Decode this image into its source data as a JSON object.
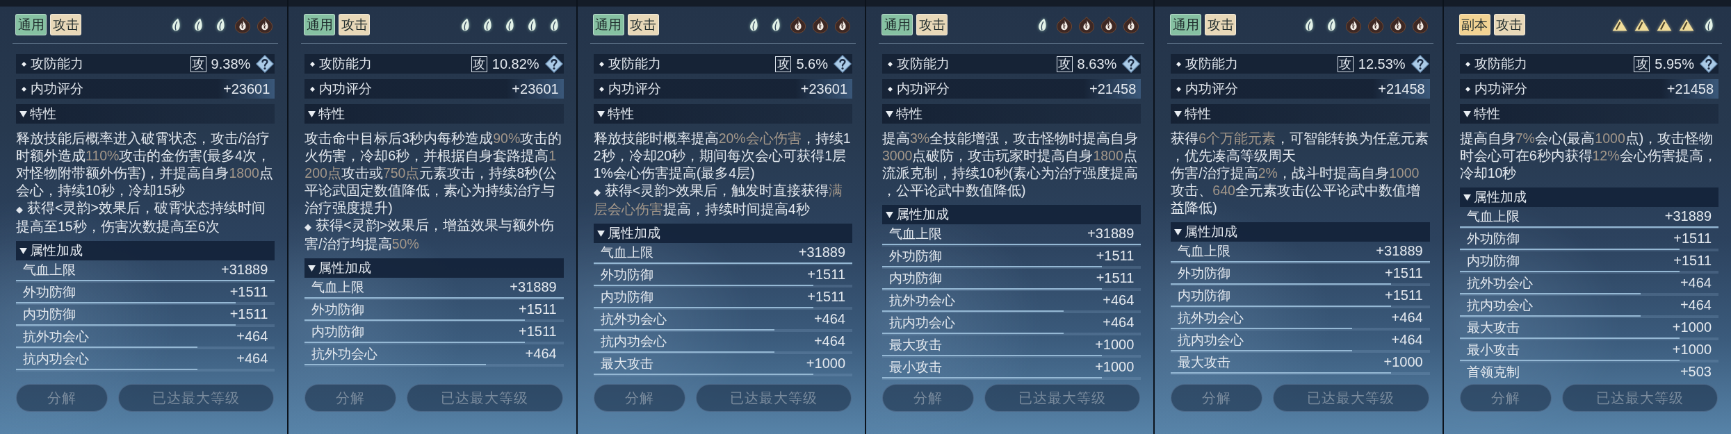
{
  "panels": [
    {
      "tags": [
        {
          "label": "通用",
          "color": "#86c1a2"
        },
        {
          "label": "攻击",
          "color": "#e8d8b8"
        }
      ],
      "elements": [
        {
          "kind": "leaf"
        },
        {
          "kind": "leaf"
        },
        {
          "kind": "leaf"
        },
        {
          "kind": "flame"
        },
        {
          "kind": "flame"
        }
      ],
      "ability": {
        "label": "攻防能力",
        "badge": "攻",
        "value": "9.38%"
      },
      "score": {
        "label": "内功评分",
        "value": "+23601"
      },
      "traits": {
        "title": "特性",
        "expanded": true,
        "paragraphs": [
          {
            "segments": [
              {
                "text": "释放技能后概率进入破霄状态，攻击/治疗时额外造成",
                "highlight": false
              },
              {
                "text": "110%",
                "highlight": true
              },
              {
                "text": "攻击的金伤害(最多4次，对怪物附带额外伤害)，并提高自身",
                "highlight": false
              },
              {
                "text": "1800",
                "highlight": true
              },
              {
                "text": "点会心，持续10秒，冷却15秒",
                "highlight": false
              }
            ]
          },
          {
            "marker": "◆",
            "segments": [
              {
                "text": "获得<灵韵>效果后，破霄状态持续时间提高至15秒，伤害次数提高至6次",
                "highlight": false
              }
            ]
          }
        ]
      },
      "attributes": {
        "title": "属性加成",
        "expanded": true,
        "rows": [
          {
            "label": "气血上限",
            "value": "+31889",
            "level": 1
          },
          {
            "label": "外功防御",
            "value": "+1511",
            "level": 0.85
          },
          {
            "label": "内功防御",
            "value": "+1511",
            "level": 0.85
          },
          {
            "label": "抗外功会心",
            "value": "+464",
            "level": 0.7
          },
          {
            "label": "抗内功会心",
            "value": "+464",
            "level": 0.7
          }
        ]
      },
      "buttons": [
        {
          "label": "分解",
          "disabled": true
        },
        {
          "label": "已达最大等级",
          "disabled": true
        }
      ]
    },
    {
      "tags": [
        {
          "label": "通用",
          "color": "#86c1a2"
        },
        {
          "label": "攻击",
          "color": "#e8d8b8"
        }
      ],
      "elements": [
        {
          "kind": "leaf"
        },
        {
          "kind": "leaf"
        },
        {
          "kind": "leaf"
        },
        {
          "kind": "leaf"
        },
        {
          "kind": "leaf"
        }
      ],
      "ability": {
        "label": "攻防能力",
        "badge": "攻",
        "value": "10.82%"
      },
      "score": {
        "label": "内功评分",
        "value": "+23601"
      },
      "traits": {
        "title": "特性",
        "expanded": true,
        "paragraphs": [
          {
            "segments": [
              {
                "text": "攻击命中目标后3秒内每秒造成",
                "highlight": false
              },
              {
                "text": "90%",
                "highlight": true
              },
              {
                "text": "攻击的火伤害，冷却6秒，并根据自身套路提高",
                "highlight": false
              },
              {
                "text": "1200点",
                "highlight": true
              },
              {
                "text": "攻击或",
                "highlight": false
              },
              {
                "text": "750点",
                "highlight": true
              },
              {
                "text": "元素攻击，持续8秒(公平论武固定数值降低，素心为持续治疗与治疗强度提升)",
                "highlight": false
              }
            ]
          },
          {
            "marker": "◆",
            "segments": [
              {
                "text": "获得<灵韵>效果后，增益效果与额外伤害/治疗均提高",
                "highlight": false
              },
              {
                "text": "50%",
                "highlight": true
              }
            ]
          }
        ]
      },
      "attributes": {
        "title": "属性加成",
        "expanded": true,
        "rows": [
          {
            "label": "气血上限",
            "value": "+31889",
            "level": 1
          },
          {
            "label": "外功防御",
            "value": "+1511",
            "level": 0.85
          },
          {
            "label": "内功防御",
            "value": "+1511",
            "level": 0.85
          },
          {
            "label": "抗外功会心",
            "value": "+464",
            "level": 0.7
          }
        ]
      },
      "buttons": [
        {
          "label": "分解",
          "disabled": true
        },
        {
          "label": "已达最大等级",
          "disabled": true
        }
      ]
    },
    {
      "tags": [
        {
          "label": "通用",
          "color": "#86c1a2"
        },
        {
          "label": "攻击",
          "color": "#e8d8b8"
        }
      ],
      "elements": [
        {
          "kind": "leaf"
        },
        {
          "kind": "leaf"
        },
        {
          "kind": "flame"
        },
        {
          "kind": "flame"
        },
        {
          "kind": "flame"
        }
      ],
      "ability": {
        "label": "攻防能力",
        "badge": "攻",
        "value": "5.6%"
      },
      "score": {
        "label": "内功评分",
        "value": "+23601"
      },
      "traits": {
        "title": "特性",
        "expanded": true,
        "paragraphs": [
          {
            "segments": [
              {
                "text": "释放技能时概率提高",
                "highlight": false
              },
              {
                "text": "20%会心伤害",
                "highlight": true
              },
              {
                "text": "，持续12秒，冷却20秒，期间每次会心可获得1层1%会心伤害提高(最多4层)",
                "highlight": false
              }
            ]
          },
          {
            "marker": "◆",
            "segments": [
              {
                "text": "获得<灵韵>效果后，触发时直接获得",
                "highlight": false
              },
              {
                "text": "满层会心伤害",
                "highlight": true
              },
              {
                "text": "提高，持续时间提高4秒",
                "highlight": false
              }
            ]
          }
        ]
      },
      "attributes": {
        "title": "属性加成",
        "expanded": true,
        "rows": [
          {
            "label": "气血上限",
            "value": "+31889",
            "level": 1
          },
          {
            "label": "外功防御",
            "value": "+1511",
            "level": 0.85
          },
          {
            "label": "内功防御",
            "value": "+1511",
            "level": 0.85
          },
          {
            "label": "抗外功会心",
            "value": "+464",
            "level": 0.7
          },
          {
            "label": "抗内功会心",
            "value": "+464",
            "level": 0.7
          },
          {
            "label": "最大攻击",
            "value": "+1000",
            "level": 0.85
          }
        ]
      },
      "buttons": [
        {
          "label": "分解",
          "disabled": true
        },
        {
          "label": "已达最大等级",
          "disabled": true
        }
      ]
    },
    {
      "tags": [
        {
          "label": "通用",
          "color": "#86c1a2"
        },
        {
          "label": "攻击",
          "color": "#e8d8b8"
        }
      ],
      "elements": [
        {
          "kind": "leaf"
        },
        {
          "kind": "flame"
        },
        {
          "kind": "flame"
        },
        {
          "kind": "flame"
        },
        {
          "kind": "flame"
        }
      ],
      "ability": {
        "label": "攻防能力",
        "badge": "攻",
        "value": "8.63%"
      },
      "score": {
        "label": "内功评分",
        "value": "+21458"
      },
      "traits": {
        "title": "特性",
        "expanded": true,
        "paragraphs": [
          {
            "segments": [
              {
                "text": "提高",
                "highlight": false
              },
              {
                "text": "3%",
                "highlight": true
              },
              {
                "text": "全技能增强，攻击怪物时提高自身",
                "highlight": false
              },
              {
                "text": "3000",
                "highlight": true
              },
              {
                "text": "点破防，攻击玩家时提高自身",
                "highlight": false
              },
              {
                "text": "1800",
                "highlight": true
              },
              {
                "text": "点流派克制，持续10秒(素心为治疗强度提高，公平论武中数值降低)",
                "highlight": false
              }
            ]
          }
        ]
      },
      "attributes": {
        "title": "属性加成",
        "expanded": true,
        "rows": [
          {
            "label": "气血上限",
            "value": "+31889",
            "level": 1
          },
          {
            "label": "外功防御",
            "value": "+1511",
            "level": 0.85
          },
          {
            "label": "内功防御",
            "value": "+1511",
            "level": 0.85
          },
          {
            "label": "抗外功会心",
            "value": "+464",
            "level": 0.7
          },
          {
            "label": "抗内功会心",
            "value": "+464",
            "level": 0.7
          },
          {
            "label": "最大攻击",
            "value": "+1000",
            "level": 0.85
          },
          {
            "label": "最小攻击",
            "value": "+1000",
            "level": 0.85
          }
        ]
      },
      "buttons": [
        {
          "label": "分解",
          "disabled": true
        },
        {
          "label": "已达最大等级",
          "disabled": true
        }
      ]
    },
    {
      "tags": [
        {
          "label": "通用",
          "color": "#86c1a2"
        },
        {
          "label": "攻击",
          "color": "#e8d8b8"
        }
      ],
      "elements": [
        {
          "kind": "leaf"
        },
        {
          "kind": "leaf"
        },
        {
          "kind": "flame"
        },
        {
          "kind": "flame"
        },
        {
          "kind": "flame"
        },
        {
          "kind": "flame"
        }
      ],
      "ability": {
        "label": "攻防能力",
        "badge": "攻",
        "value": "12.53%"
      },
      "score": {
        "label": "内功评分",
        "value": "+21458"
      },
      "traits": {
        "title": "特性",
        "expanded": true,
        "paragraphs": [
          {
            "segments": [
              {
                "text": "获得",
                "highlight": false
              },
              {
                "text": "6个万能元素",
                "highlight": true
              },
              {
                "text": "，可智能转换为任意元素，优先凑高等级周天",
                "highlight": false
              }
            ]
          },
          {
            "segments": [
              {
                "text": "伤害/治疗提高",
                "highlight": false
              },
              {
                "text": "2%",
                "highlight": true
              },
              {
                "text": "，战斗时提高自身",
                "highlight": false
              },
              {
                "text": "1000",
                "highlight": true
              },
              {
                "text": "攻击、",
                "highlight": false
              },
              {
                "text": "640",
                "highlight": true
              },
              {
                "text": "全元素攻击(公平论武中数值增益降低)",
                "highlight": false
              }
            ]
          }
        ]
      },
      "attributes": {
        "title": "属性加成",
        "expanded": true,
        "rows": [
          {
            "label": "气血上限",
            "value": "+31889",
            "level": 1
          },
          {
            "label": "外功防御",
            "value": "+1511",
            "level": 0.85
          },
          {
            "label": "内功防御",
            "value": "+1511",
            "level": 0.85
          },
          {
            "label": "抗外功会心",
            "value": "+464",
            "level": 0.7
          },
          {
            "label": "抗内功会心",
            "value": "+464",
            "level": 0.7
          },
          {
            "label": "最大攻击",
            "value": "+1000",
            "level": 0.85
          }
        ]
      },
      "buttons": [
        {
          "label": "分解",
          "disabled": true
        },
        {
          "label": "已达最大等级",
          "disabled": true
        }
      ]
    },
    {
      "tags": [
        {
          "label": "副本",
          "color": "#f2d393"
        },
        {
          "label": "攻击",
          "color": "#e8d8b8"
        }
      ],
      "elements": [
        {
          "kind": "triangle"
        },
        {
          "kind": "triangle"
        },
        {
          "kind": "triangle"
        },
        {
          "kind": "triangle"
        },
        {
          "kind": "leaf"
        }
      ],
      "ability": {
        "label": "攻防能力",
        "badge": "攻",
        "value": "5.95%"
      },
      "score": {
        "label": "内功评分",
        "value": "+21458"
      },
      "traits": {
        "title": "特性",
        "expanded": true,
        "paragraphs": [
          {
            "segments": [
              {
                "text": "提高自身",
                "highlight": false
              },
              {
                "text": "7%",
                "highlight": true
              },
              {
                "text": "会心(最高",
                "highlight": false
              },
              {
                "text": "1000",
                "highlight": true
              },
              {
                "text": "点)，攻击怪物时会心可在6秒内获得",
                "highlight": false
              },
              {
                "text": "12%",
                "highlight": true
              },
              {
                "text": "会心伤害提高，冷却10秒",
                "highlight": false
              }
            ]
          }
        ]
      },
      "attributes": {
        "title": "属性加成",
        "expanded": true,
        "rows": [
          {
            "label": "气血上限",
            "value": "+31889",
            "level": 1
          },
          {
            "label": "外功防御",
            "value": "+1511",
            "level": 0.85
          },
          {
            "label": "内功防御",
            "value": "+1511",
            "level": 0.85
          },
          {
            "label": "抗外功会心",
            "value": "+464",
            "level": 0.7
          },
          {
            "label": "抗内功会心",
            "value": "+464",
            "level": 0.7
          },
          {
            "label": "最大攻击",
            "value": "+1000",
            "level": 0.85
          },
          {
            "label": "最小攻击",
            "value": "+1000",
            "level": 0.85
          },
          {
            "label": "首领克制",
            "value": "+503"
          }
        ]
      },
      "buttons": [
        {
          "label": "分解",
          "disabled": true
        },
        {
          "label": "已达最大等级",
          "disabled": true
        }
      ]
    }
  ]
}
